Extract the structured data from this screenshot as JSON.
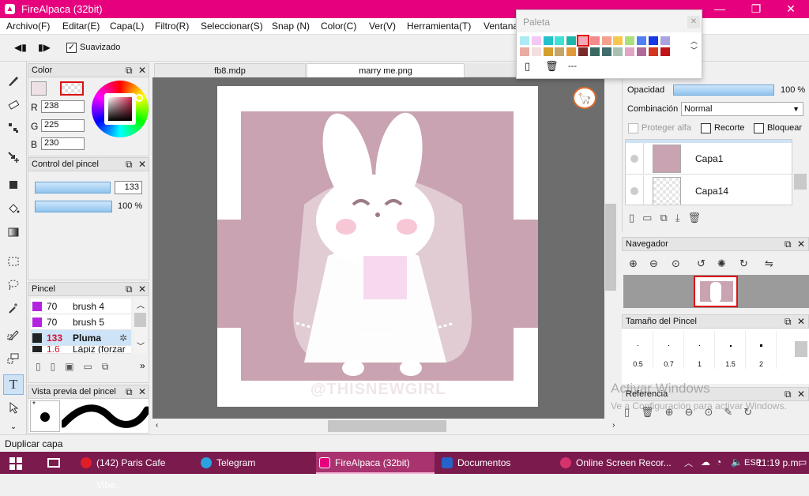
{
  "window": {
    "title": "FireAlpaca (32bit)"
  },
  "menu": [
    "Archivo(F)",
    "Editar(E)",
    "Capa(L)",
    "Filtro(R)",
    "Seleccionar(S)",
    "Snap (N)",
    "Color(C)",
    "Ver(V)",
    "Herramienta(T)",
    "Ventana"
  ],
  "toolbar": {
    "smoothing_label": "Suavizado"
  },
  "palette": {
    "title": "Paleta",
    "row1": [
      "#aee9f6",
      "#f4c7f4",
      "#22c2c8",
      "#3fe0d6",
      "#1fb5a9",
      "#f6a6b6",
      "#f48b8b",
      "#f5a08a",
      "#f8c64a",
      "#a8e07a",
      "#4f7ff2",
      "#1738e6",
      "#aaa3df"
    ],
    "row2": [
      "#e9aca3",
      "#f3dede",
      "#d49f2e",
      "#c4a56a",
      "#e2993a",
      "#7b2a2a",
      "#3b6a63",
      "#3e6d6c",
      "#a7c1b0",
      "#dfa7c3",
      "#b06a9a",
      "#d4361f",
      "#c0131a"
    ],
    "dashes": "---"
  },
  "tabs": [
    {
      "label": "fb8.mdp"
    },
    {
      "label": "marry me.png"
    }
  ],
  "color_panel": {
    "title": "Color",
    "r_label": "R",
    "g_label": "G",
    "b_label": "B",
    "r": "238",
    "g": "225",
    "b": "230",
    "swatch": "#eee1e6"
  },
  "brush_control": {
    "title": "Control del pincel",
    "size": "133",
    "opacity": "100 %"
  },
  "brushes": {
    "title": "Pincel",
    "items": [
      {
        "size": "70",
        "name": "brush 4",
        "color": "#b324e0"
      },
      {
        "size": "70",
        "name": "brush 5",
        "color": "#b324e0"
      },
      {
        "size": "133",
        "name": "Pluma",
        "color": "#222222"
      },
      {
        "size": "1.6",
        "name": "Lápiz (forzar d",
        "color": "#222222"
      }
    ]
  },
  "brush_preview": {
    "title": "Vista previa del pincel",
    "marker": "*"
  },
  "layers": {
    "opacity_label": "Opacidad",
    "opacity_value": "100 %",
    "blend_label": "Combinación",
    "blend_value": "Normal",
    "protect_alpha": "Proteger alfa",
    "clip": "Recorte",
    "lock": "Bloquear",
    "items": [
      {
        "name": "Capa1"
      },
      {
        "name": "Capa14"
      }
    ]
  },
  "navigator": {
    "title": "Navegador"
  },
  "brush_size": {
    "title": "Tamaño del Pincel",
    "sizes": [
      "0.5",
      "0.7",
      "1",
      "1.5",
      "2"
    ]
  },
  "reference": {
    "title": "Referencia"
  },
  "watermark": {
    "line1": "Activar Windows",
    "line2": "Ve a Configuración para activar Windows."
  },
  "canvas": {
    "artwork_text": "@THISNEWGIRL",
    "bg": "#c9a3b1"
  },
  "status": {
    "text": "Duplicar capa"
  },
  "taskbar": {
    "items": [
      {
        "label": "(142) Paris Cafe Vibe...",
        "color": "#e11d2a"
      },
      {
        "label": "Telegram",
        "color": "#2aa3e0"
      },
      {
        "label": "FireAlpaca (32bit)",
        "color": "#e6007e"
      },
      {
        "label": "Documentos",
        "color": "#2563c9"
      },
      {
        "label": "Online Screen Recor...",
        "color": "#d6336c"
      }
    ],
    "lang": "ESP",
    "time": "11:19 p.m."
  }
}
